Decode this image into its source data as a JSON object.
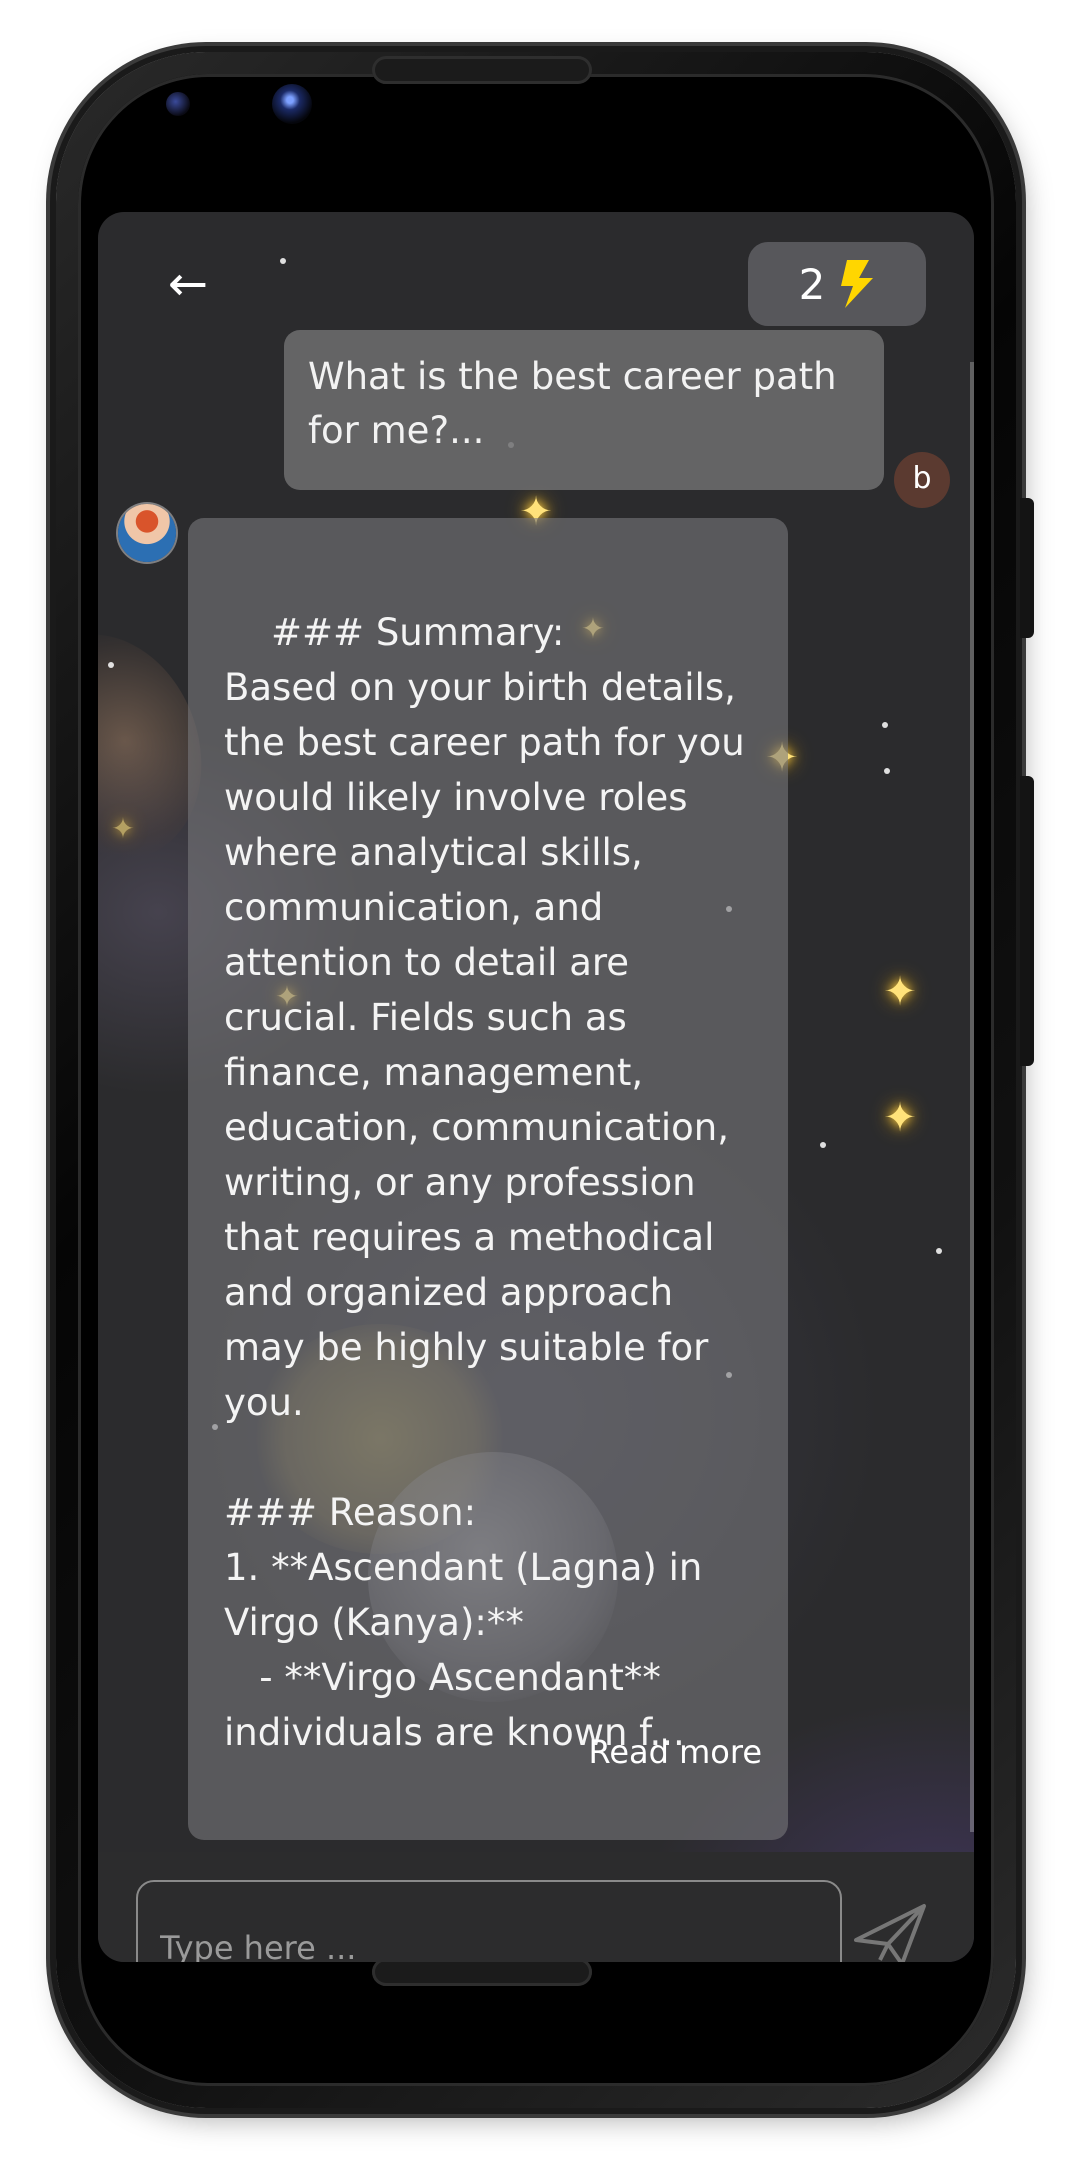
{
  "header": {
    "back_label": "←",
    "credits_count": "2",
    "credits_icon": "lightning-bolt-icon"
  },
  "conversation": {
    "user_message": "What is the best career path for me?...",
    "user_avatar_letter": "b",
    "bot_message": "### Summary:\nBased on your birth details, the best career path for you would likely involve roles where analytical skills, communication, and attention to detail are crucial. Fields such as finance, management, education, communication, writing, or any profession that requires a methodical and organized approach may be highly suitable for you.\n\n### Reason:\n1. **Ascendant (Lagna) in Virgo (Kanya):**\n   - **Virgo Ascendant** individuals are known f...",
    "read_more_label": "Read more"
  },
  "composer": {
    "placeholder": "Type here ...",
    "send_icon": "paper-plane-icon"
  },
  "colors": {
    "accent_bolt": "#ffd600",
    "user_avatar_bg": "#5b3a30",
    "screen_bg": "#2b2b2d"
  }
}
